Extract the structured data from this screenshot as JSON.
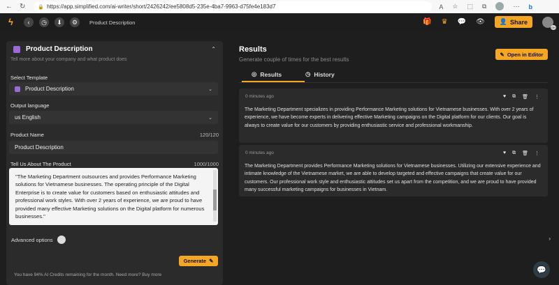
{
  "browser": {
    "url": "https://app.simplified.com/ai-writer/short/2426242/ee5808d5-235e-4ba7-9963-d75fe4e183d7",
    "reader_label": "A",
    "profile_label": "b"
  },
  "appbar": {
    "breadcrumb": "Product Description",
    "share_label": "Share",
    "avatar_initials": "OH"
  },
  "left": {
    "title": "Product Description",
    "subtitle": "Tell more about your company and what product does",
    "template_label": "Select Template",
    "template_value": "Product Description",
    "language_label": "Output language",
    "language_value": "us English",
    "product_name_label": "Product Name",
    "product_name_count": "120/120",
    "product_name_value": "Product Description",
    "tell_us_label": "Tell Us About The Product",
    "tell_us_count": "1000/1000",
    "tell_us_value": "\"The Marketing Department outsources and provides Performance Marketing solutions for Vietnamese businesses. The operating principle of the Digital Enterprise is to create value for customers based on enthusiastic attitudes and professional work styles. With over 2 years of experience, we are proud to have provided many effective Marketing solutions on the Digital platform for numerous businesses.\"",
    "advanced_label": "Advanced options",
    "generate_label": "Generate",
    "footnote": "You have 94% AI Credits remaining for the month. Need more?  Buy more"
  },
  "results": {
    "title": "Results",
    "subtitle": "Generate couple of times for the best results",
    "open_editor_label": "Open in Editor",
    "tabs": [
      {
        "label": "Results"
      },
      {
        "label": "History"
      }
    ],
    "cards": [
      {
        "time": "0 minutes ago",
        "text": "The Marketing Department specializes in providing Performance Marketing solutions for Vietnamese businesses. With over 2 years of experience, we have become experts in delivering effective Marketing campaigns on the Digital platform for our clients. Our goal is always to create value for our customers by providing enthusiastic service and professional workmanship."
      },
      {
        "time": "0 minutes ago",
        "text": "The Marketing Department provides Performance Marketing solutions for Vietnamese businesses. Utilizing our extensive experience and intimate knowledge of the Vietnamese market, we are able to develop targeted and effective campaigns that create value for our customers. Our professional work style and enthusiastic attitudes set us apart from the competition, and we are proud to have provided many successful marketing campaigns for businesses in Vietnam."
      }
    ]
  },
  "colors": {
    "accent": "#f5a623",
    "panel": "#2b2b2b",
    "background": "#1e1e1e"
  }
}
